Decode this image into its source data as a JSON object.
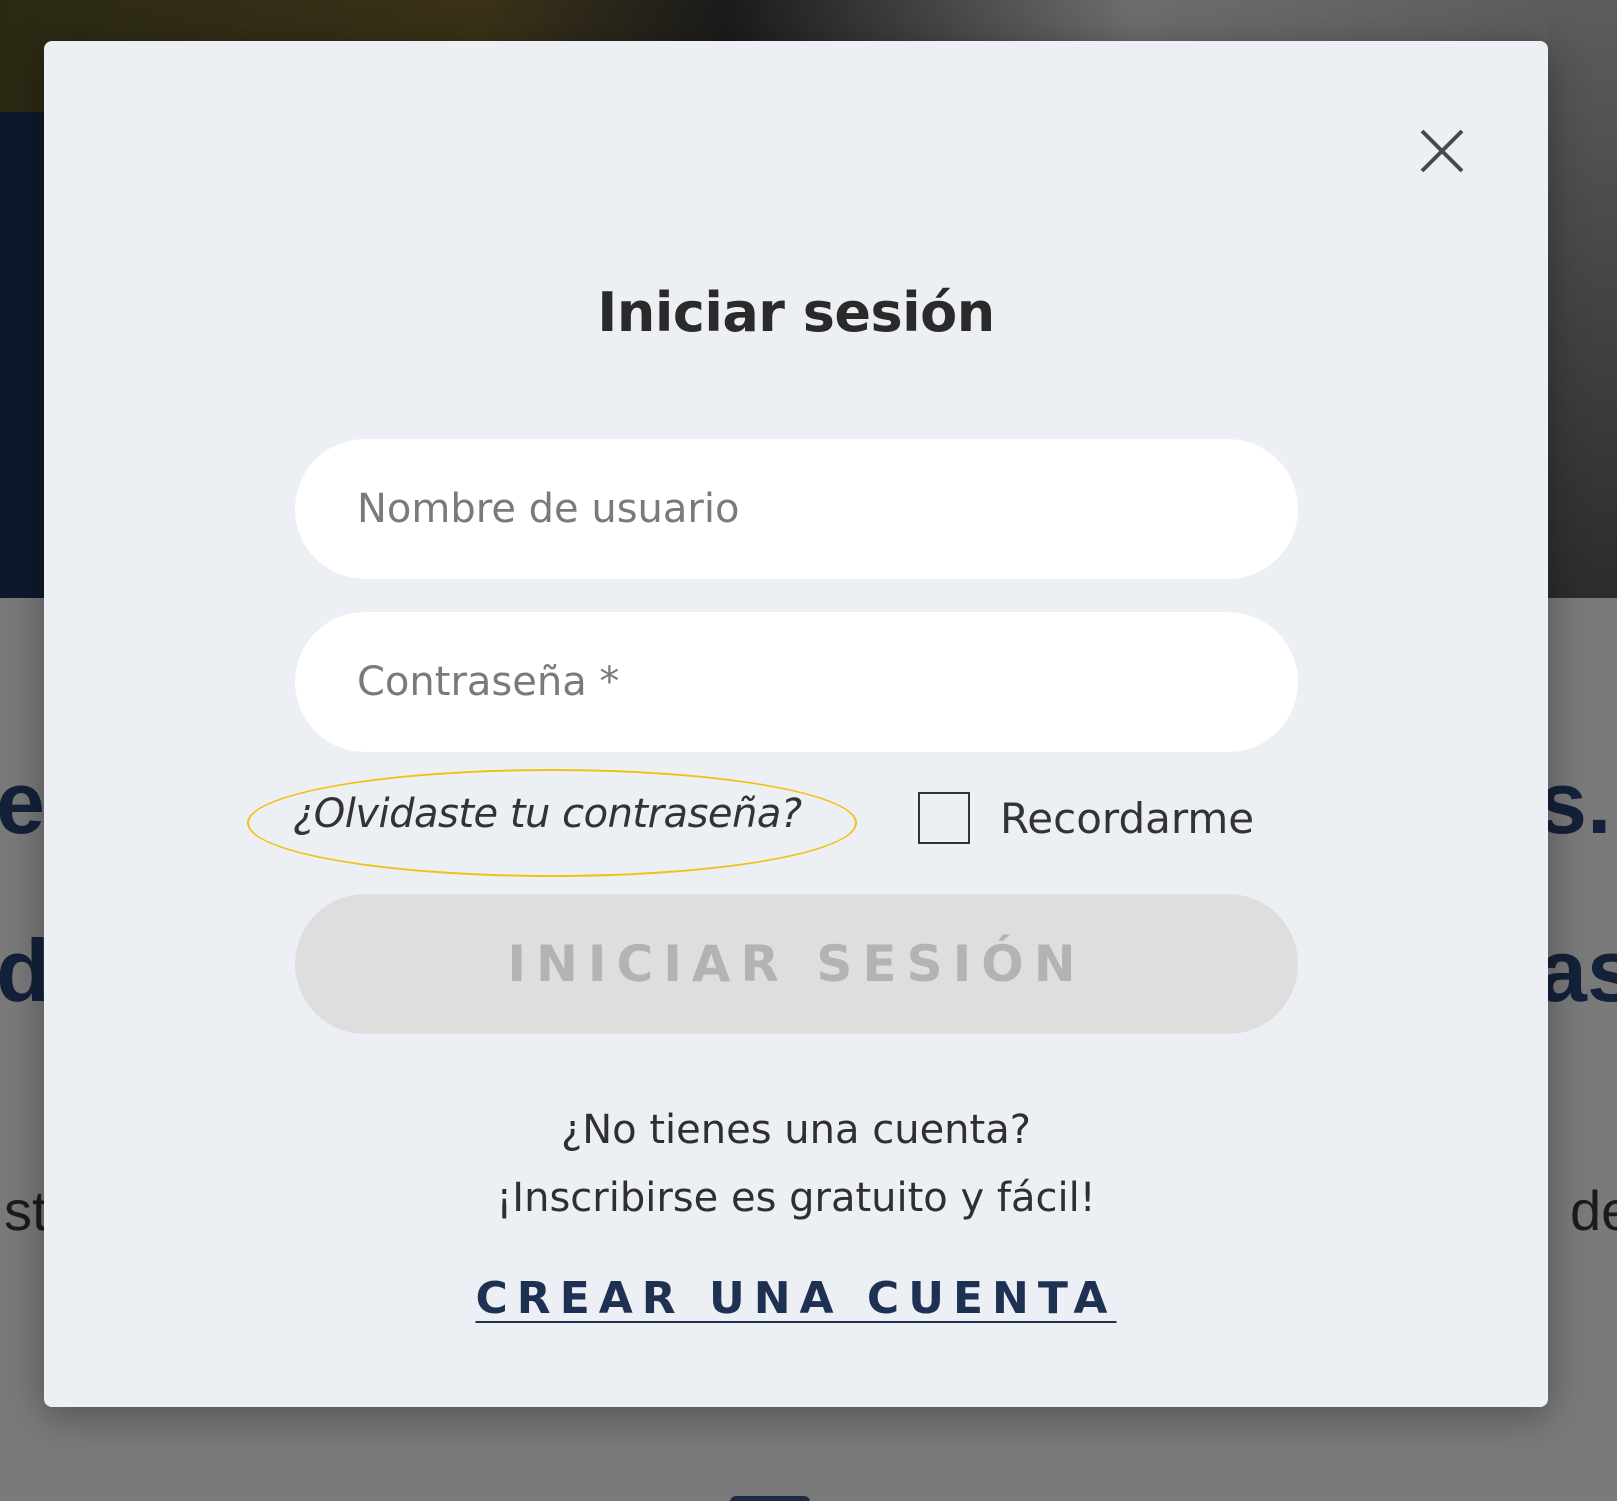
{
  "background": {
    "fragments": {
      "left_line1": "e",
      "left_line2": "d",
      "left_line3": "st",
      "right_line1": "s.",
      "right_line2": "as",
      "right_line3": "de"
    }
  },
  "modal": {
    "title": "Iniciar sesión",
    "close_icon": "close-icon",
    "username": {
      "placeholder": "Nombre de usuario",
      "value": ""
    },
    "password": {
      "placeholder": "Contraseña *",
      "value": ""
    },
    "forgot_password_label": "¿Olvidaste tu contraseña?",
    "remember_me": {
      "label": "Recordarme",
      "checked": false
    },
    "submit_label": "INICIAR SESIÓN",
    "no_account_question": "¿No tienes una cuenta?",
    "signup_pitch": "¡Inscribirse es gratuito y fácil!",
    "create_account_label": "CREAR UNA CUENTA"
  },
  "colors": {
    "modal_bg": "#eceff4",
    "highlight_ring": "#f0c20e",
    "link": "#1f3153",
    "disabled_button": "#dedede"
  }
}
